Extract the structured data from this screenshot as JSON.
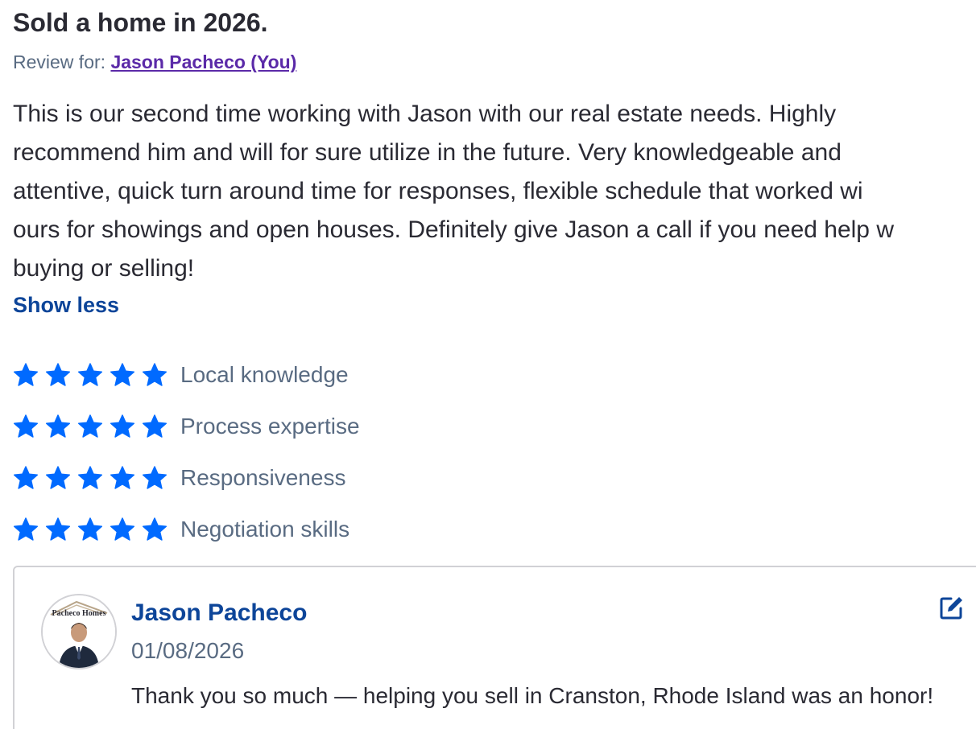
{
  "review": {
    "title": "Sold a home in 2026.",
    "review_for_label": "Review for: ",
    "agent_link": "Jason Pacheco (You)",
    "body_lines": [
      "This is our second time working with Jason with our real estate needs. Highly",
      "recommend him and will for sure utilize in the future. Very knowledgeable and",
      "attentive, quick turn around time for responses, flexible schedule that worked wi",
      "ours for showings and open houses. Definitely give Jason a call if you need help w",
      "buying or selling!"
    ],
    "show_less_label": "Show less"
  },
  "ratings": [
    {
      "label": "Local knowledge",
      "stars": 5,
      "max": 5
    },
    {
      "label": "Process expertise",
      "stars": 5,
      "max": 5
    },
    {
      "label": "Responsiveness",
      "stars": 5,
      "max": 5
    },
    {
      "label": "Negotiation skills",
      "stars": 5,
      "max": 5
    }
  ],
  "reply": {
    "avatar_logo_text": "Pacheco Homes",
    "name": "Jason Pacheco",
    "date": "01/08/2026",
    "text": "Thank you so much — helping you sell in Cranston, Rhode Island was an honor!",
    "edit_icon": "edit-icon"
  },
  "colors": {
    "star": "#006aff",
    "link_purple": "#5b2aa8",
    "link_blue": "#0d4599",
    "muted": "#596b82",
    "text": "#2a2a33",
    "border": "#d1d1d5"
  }
}
